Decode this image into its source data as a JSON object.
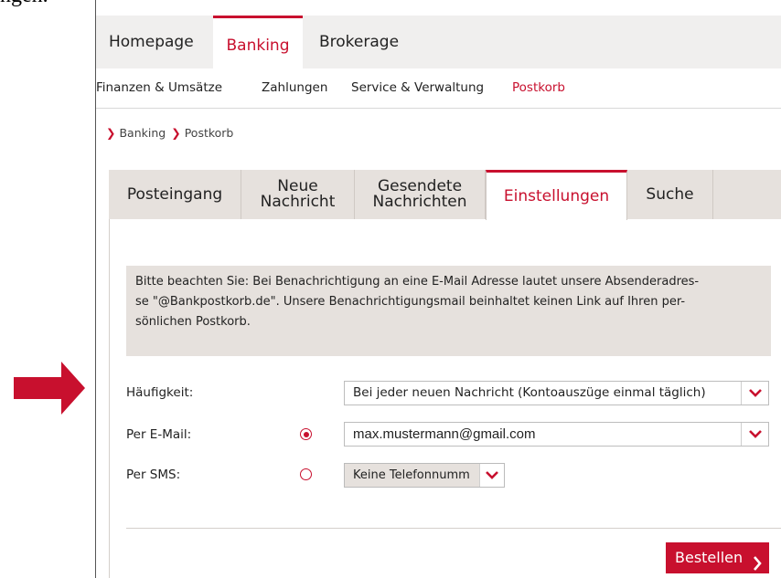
{
  "background_text": "ngen.",
  "topnav": {
    "tabs": [
      {
        "label": "Homepage"
      },
      {
        "label": "Banking"
      },
      {
        "label": "Brokerage"
      }
    ],
    "active_color": "#c8102e"
  },
  "subnav": {
    "items": [
      {
        "label": "Finanzen & Umsätze"
      },
      {
        "label": "Zahlungen"
      },
      {
        "label": "Service & Verwaltung"
      },
      {
        "label": "Postkorb"
      }
    ]
  },
  "breadcrumb": [
    "Banking",
    "Postkorb"
  ],
  "postkorb_tabs": [
    {
      "label": "Posteingang"
    },
    {
      "label_line1": "Neue",
      "label_line2": "Nachricht"
    },
    {
      "label_line1": "Gesendete",
      "label_line2": "Nachrichten"
    },
    {
      "label": "Einstellungen"
    },
    {
      "label": "Suche"
    }
  ],
  "notice": {
    "line1": "Bitte beachten Sie: Bei Benachrichtigung an eine E-Mail Adresse lautet unsere Absenderadres-",
    "line2": "se \"@Bankpostkorb.de\". Unsere Benachrichtigungsmail beinhaltet keinen Link auf Ihren per-",
    "line3": "sönlichen Postkorb."
  },
  "form": {
    "frequency_label": "Häufigkeit:",
    "frequency_value": "Bei jeder neuen Nachricht (Kontoauszüge einmal täglich)",
    "email_label": "Per E-Mail:",
    "email_value": "max.mustermann@gmail.com",
    "email_selected": true,
    "sms_label": "Per SMS:",
    "sms_value": "Keine Telefonnumm",
    "sms_selected": false
  },
  "order_button": {
    "label": "Bestellen"
  },
  "colors": {
    "accent": "#c8102e",
    "tab_bg": "#e6e1dd",
    "nav_bg": "#f0efee"
  },
  "icons": [
    "chevron-right-icon",
    "chevron-down-icon",
    "radio-selected-icon",
    "radio-unselected-icon",
    "arrow-right-icon"
  ]
}
